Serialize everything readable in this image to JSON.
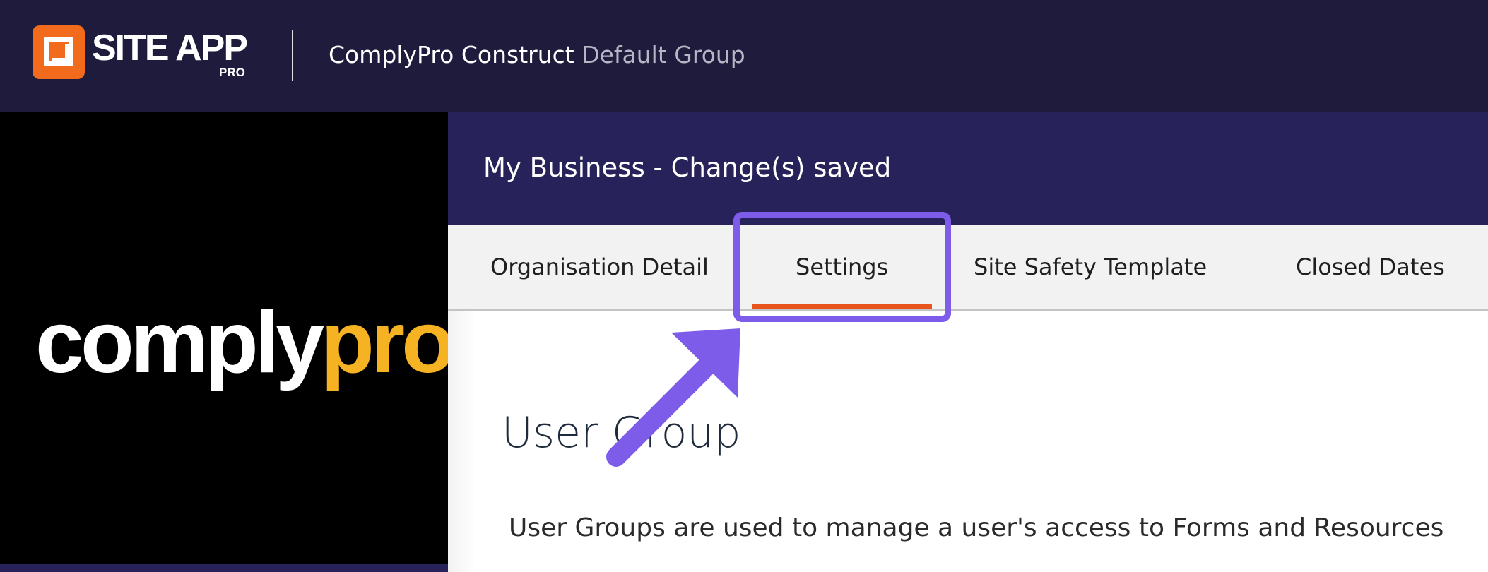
{
  "topbar": {
    "brand_name": "SITE APP",
    "brand_sub": "PRO",
    "org_name": "ComplyPro Construct",
    "group_name": "Default Group"
  },
  "left_panel": {
    "logo_word_light": "comply",
    "logo_word_accent": "pro"
  },
  "main": {
    "title": "My Business - Change(s) saved",
    "tabs": [
      {
        "label": "Organisation Detail",
        "active": false
      },
      {
        "label": "Settings",
        "active": true
      },
      {
        "label": "Site Safety Template",
        "active": false
      },
      {
        "label": "Closed Dates",
        "active": false
      }
    ],
    "section_title": "User Group",
    "section_description": "User Groups are used to manage a user's access to Forms and Resources"
  },
  "colors": {
    "topbar_bg": "#1e1b3c",
    "header_bg": "#27235a",
    "brand_orange": "#f26b1d",
    "tab_active_underline": "#e8551c",
    "annotation_purple": "#7c5ce8",
    "logo_accent": "#f5b223"
  },
  "icons": {
    "brand_logo": "site-app-logo-icon",
    "annotation_arrow": "pointer-arrow-icon"
  }
}
